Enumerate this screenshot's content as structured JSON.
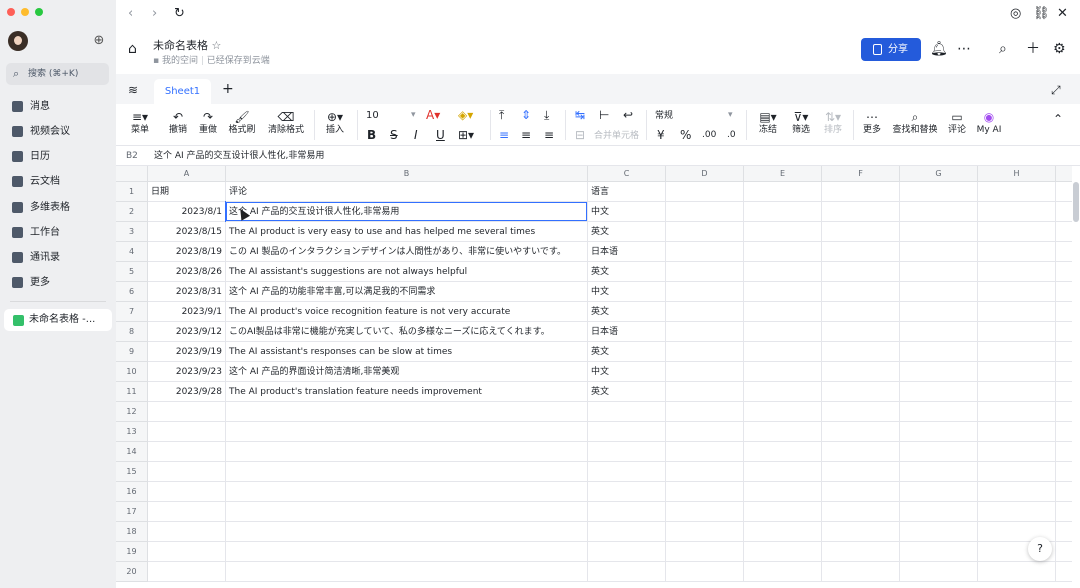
{
  "sidebar": {
    "search_label": "搜索 (⌘+K)",
    "items": [
      {
        "label": "消息",
        "icon": "message-icon"
      },
      {
        "label": "视频会议",
        "icon": "video-icon"
      },
      {
        "label": "日历",
        "icon": "calendar-icon"
      },
      {
        "label": "云文档",
        "icon": "cloud-doc-icon"
      },
      {
        "label": "多维表格",
        "icon": "base-icon"
      },
      {
        "label": "工作台",
        "icon": "workplace-icon"
      },
      {
        "label": "通讯录",
        "icon": "contacts-icon"
      },
      {
        "label": "更多",
        "icon": "more-icon"
      }
    ],
    "active_file": "未命名表格 -..."
  },
  "header": {
    "title": "未命名表格",
    "location": "我的空间",
    "save_status": "已经保存到云端",
    "share_label": "分享"
  },
  "tabs": {
    "sheet1": "Sheet1"
  },
  "toolbar": {
    "menu": "菜单",
    "undo": "撤销",
    "redo": "重做",
    "format_painter": "格式刷",
    "clear_format": "清除格式",
    "insert": "插入",
    "font_size": "10",
    "merge": "合并单元格",
    "number_format": "常规",
    "freeze": "冻结",
    "filter": "筛选",
    "sort": "排序",
    "more": "更多",
    "find_replace": "查找和替换",
    "comment": "评论",
    "my_ai": "My AI"
  },
  "formula_bar": {
    "cell_ref": "B2",
    "content": "这个 AI 产品的交互设计很人性化,非常易用"
  },
  "columns": [
    "A",
    "B",
    "C",
    "D",
    "E",
    "F",
    "G",
    "H"
  ],
  "rows": [
    {
      "a": "日期",
      "b": "评论",
      "c": "语言"
    },
    {
      "a": "2023/8/1",
      "b": "这个 AI 产品的交互设计很人性化,非常易用",
      "c": "中文"
    },
    {
      "a": "2023/8/15",
      "b": "The AI product is very easy to use and has helped me several times",
      "c": "英文"
    },
    {
      "a": "2023/8/19",
      "b": "この AI 製品のインタラクションデザインは人間性があり、非常に使いやすいです。",
      "c": "日本语"
    },
    {
      "a": "2023/8/26",
      "b": "The AI assistant's suggestions are not always helpful",
      "c": "英文"
    },
    {
      "a": "2023/8/31",
      "b": "这个 AI 产品的功能非常丰富,可以满足我的不同需求",
      "c": "中文"
    },
    {
      "a": "2023/9/1",
      "b": "The AI product's voice recognition feature is not very accurate",
      "c": "英文"
    },
    {
      "a": "2023/9/12",
      "b": "このAI製品は非常に機能が充実していて、私の多様なニーズに応えてくれます。",
      "c": "日本语"
    },
    {
      "a": "2023/9/19",
      "b": "The AI assistant's responses can be slow at times",
      "c": "英文"
    },
    {
      "a": "2023/9/23",
      "b": "这个 AI 产品的界面设计简洁清晰,非常美观",
      "c": "中文"
    },
    {
      "a": "2023/9/28",
      "b": "The AI product's translation feature needs improvement",
      "c": "英文"
    }
  ],
  "row_numbers": [
    "1",
    "2",
    "3",
    "4",
    "5",
    "6",
    "7",
    "8",
    "9",
    "10",
    "11",
    "12",
    "13",
    "14",
    "15",
    "16",
    "17",
    "18",
    "19",
    "20"
  ]
}
